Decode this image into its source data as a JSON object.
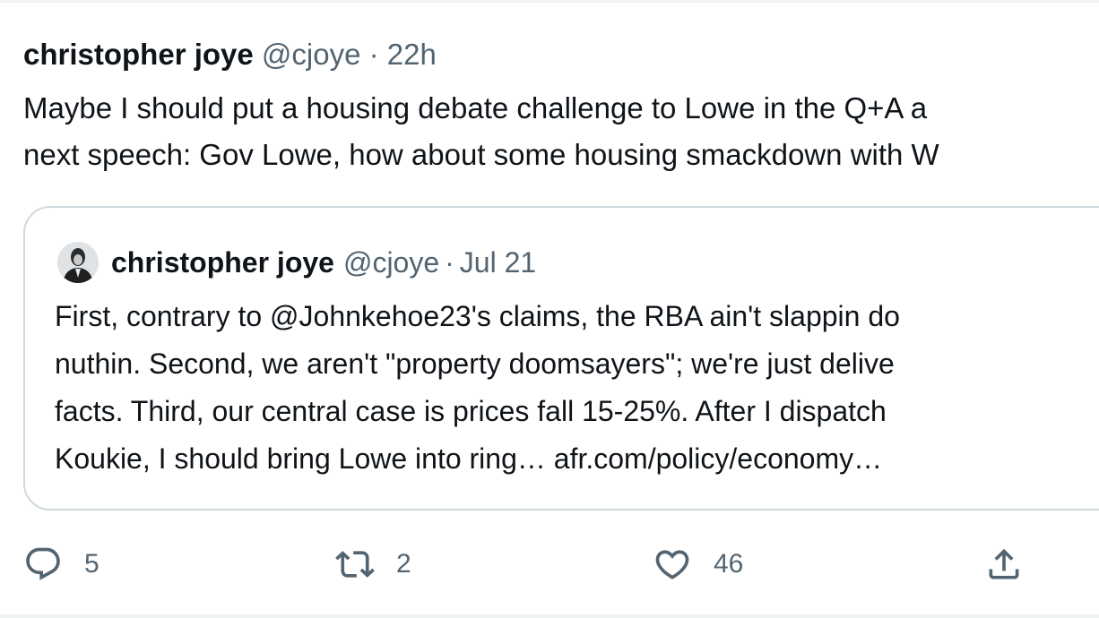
{
  "tweet": {
    "author_name": "christopher joye",
    "handle": "@cjoye",
    "separator": "·",
    "time": "22h",
    "text_lines": [
      "Maybe I should put a housing debate challenge to Lowe in the Q+A a",
      "next speech: Gov Lowe, how about some housing smackdown with W"
    ]
  },
  "quoted_tweet": {
    "author_name": "christopher joye",
    "handle": "@cjoye",
    "separator": "·",
    "date": "Jul 21",
    "text_lines": [
      "First, contrary to @Johnkehoe23's claims, the RBA ain't slappin do",
      "nuthin. Second, we aren't \"property doomsayers\"; we're just delive",
      "facts. Third, our central case is prices fall 15-25%. After I dispatch",
      "Koukie, I should bring Lowe into ring… "
    ],
    "link_text": "afr.com/policy/economy…"
  },
  "actions": {
    "reply_count": "5",
    "retweet_count": "2",
    "like_count": "46"
  },
  "icons": {
    "reply": "reply-icon",
    "retweet": "retweet-icon",
    "like": "heart-icon",
    "share": "share-icon"
  },
  "colors": {
    "text": "#0f1419",
    "muted": "#536471",
    "border": "#cfd9de",
    "divider": "#eff3f4"
  }
}
